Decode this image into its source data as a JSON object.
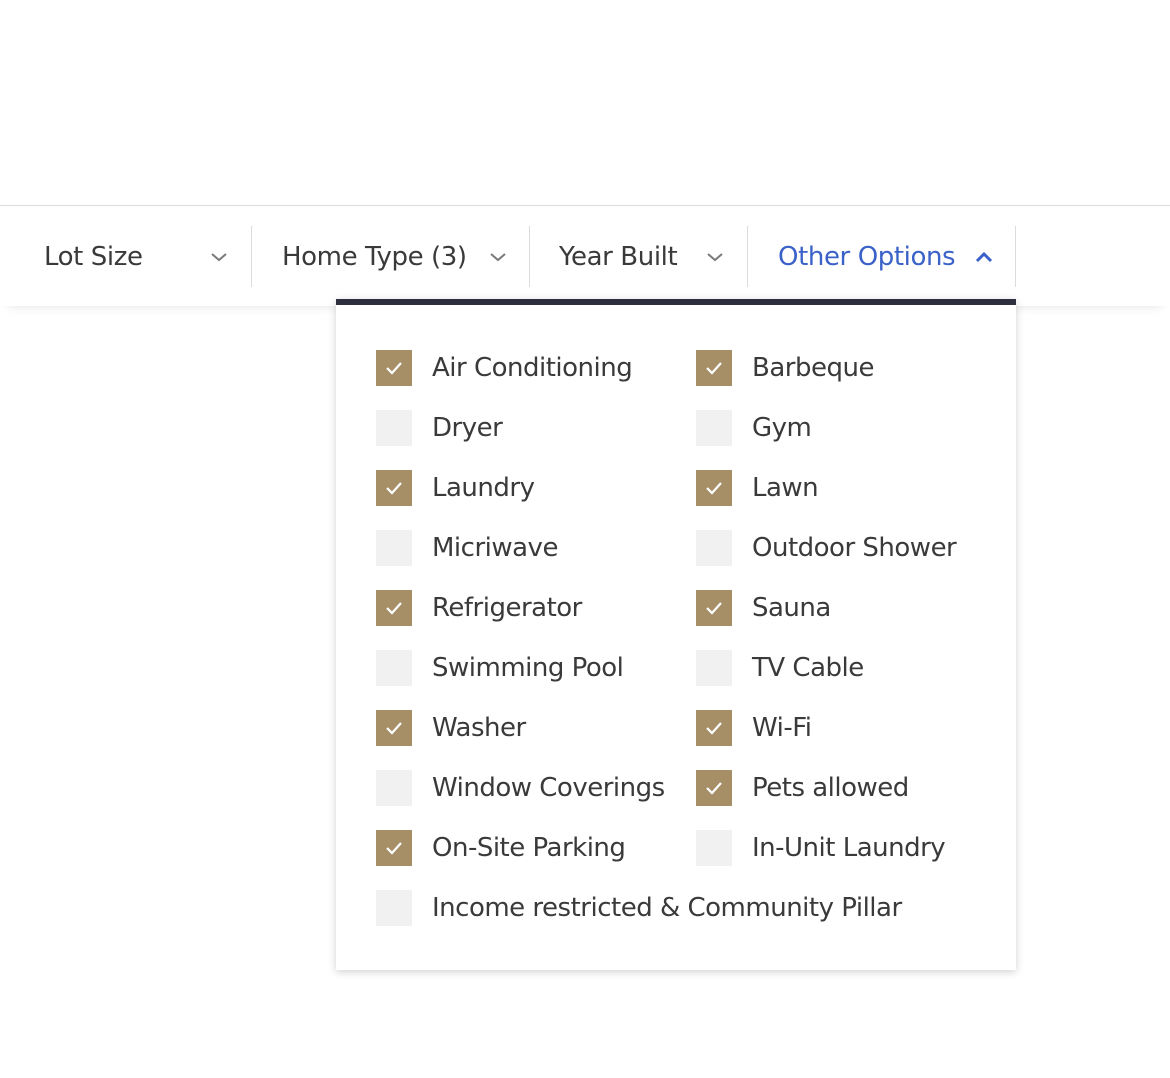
{
  "filters": [
    {
      "label": "Lot Size",
      "state": "collapsed"
    },
    {
      "label": "Home Type (3)",
      "state": "collapsed"
    },
    {
      "label": "Year Built",
      "state": "collapsed"
    },
    {
      "label": "Other Options",
      "state": "expanded"
    }
  ],
  "colors": {
    "accent_active": "#3b62c9",
    "checkbox_checked": "#a68f67",
    "checkbox_unchecked": "#f1f1f1",
    "dropdown_top_border": "#2e2f3e"
  },
  "options": [
    {
      "label": "Air Conditioning",
      "checked": true
    },
    {
      "label": "Barbeque",
      "checked": true
    },
    {
      "label": "Dryer",
      "checked": false
    },
    {
      "label": "Gym",
      "checked": false
    },
    {
      "label": "Laundry",
      "checked": true
    },
    {
      "label": "Lawn",
      "checked": true
    },
    {
      "label": "Micriwave",
      "checked": false
    },
    {
      "label": "Outdoor Shower",
      "checked": false
    },
    {
      "label": "Refrigerator",
      "checked": true
    },
    {
      "label": "Sauna",
      "checked": true
    },
    {
      "label": "Swimming Pool",
      "checked": false
    },
    {
      "label": "TV Cable",
      "checked": false
    },
    {
      "label": "Washer",
      "checked": true
    },
    {
      "label": "Wi-Fi",
      "checked": true
    },
    {
      "label": "Window Coverings",
      "checked": false
    },
    {
      "label": "Pets allowed",
      "checked": true
    },
    {
      "label": "On-Site Parking",
      "checked": true
    },
    {
      "label": "In-Unit Laundry",
      "checked": false
    },
    {
      "label": "Income restricted & Community Pillar",
      "checked": false
    }
  ]
}
